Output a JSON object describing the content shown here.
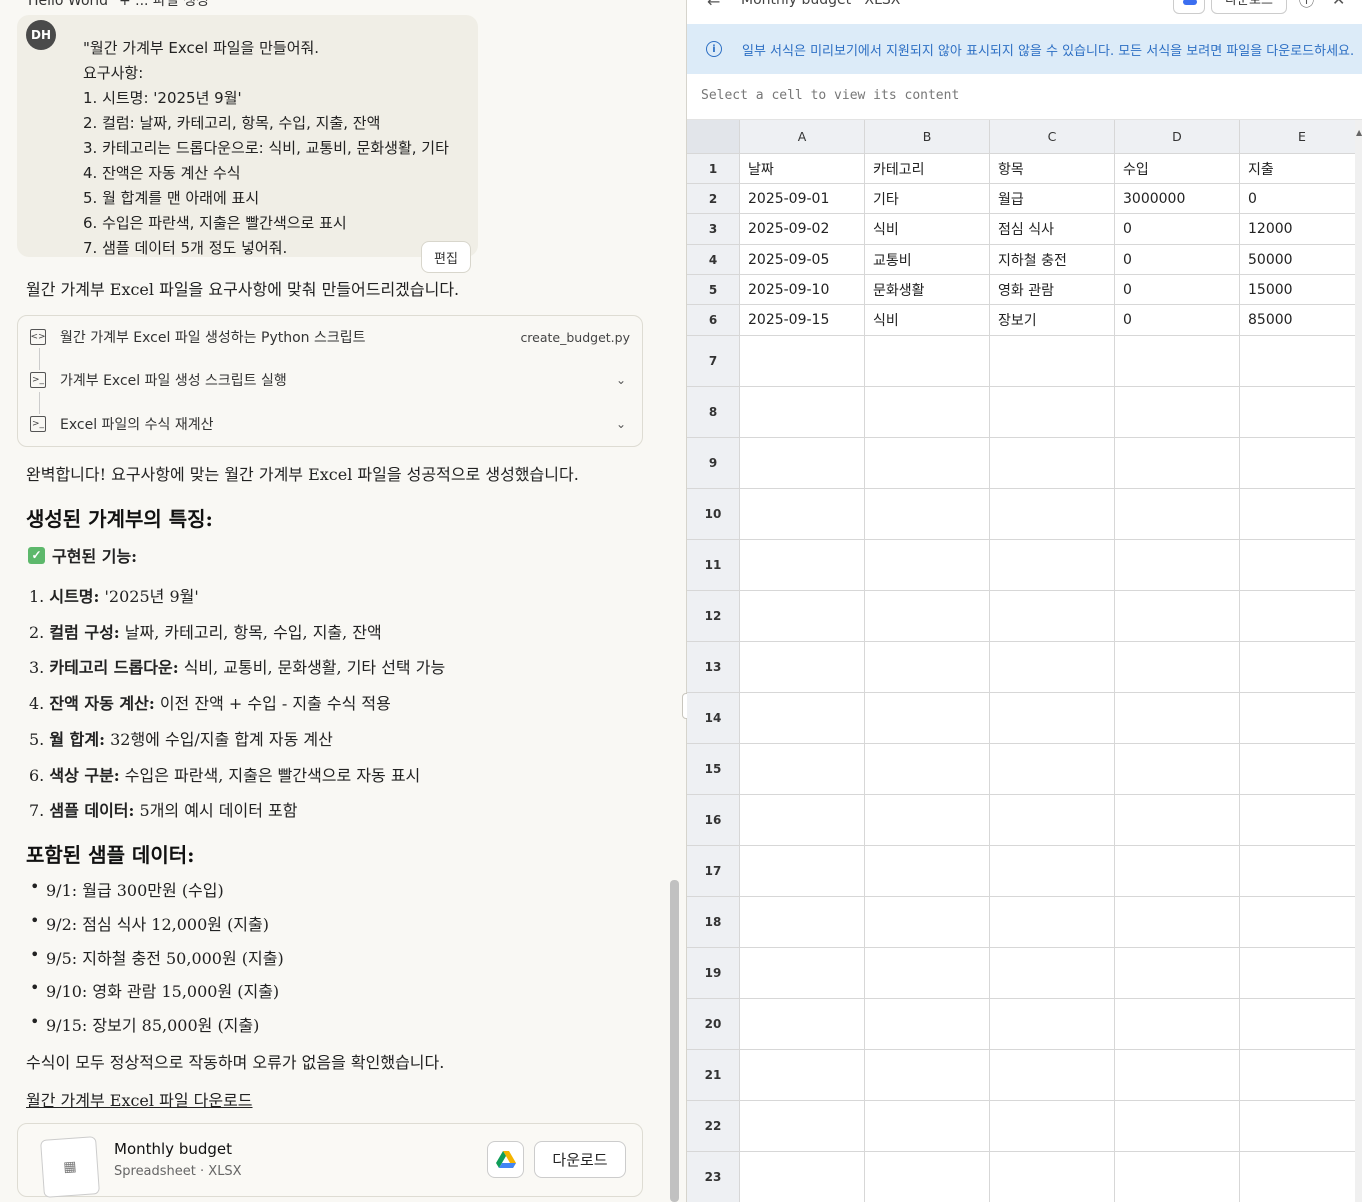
{
  "chat": {
    "top_cut_text": "Hello World\" + ... 파일 생성",
    "user": {
      "avatar": "DH",
      "lines": [
        "\"월간 가계부 Excel 파일을 만들어줘.",
        "요구사항:",
        "1. 시트명: '2025년 9월'",
        "2. 컬럼: 날짜, 카테고리, 항목, 수입, 지출, 잔액",
        "3. 카테고리는 드롭다운으로: 식비, 교통비, 문화생활, 기타",
        "4. 잔액은 자동 계산 수식",
        "5. 월 합계를 맨 아래에 표시",
        "6. 수입은 파란색, 지출은 빨간색으로 표시",
        "7. 샘플 데이터 5개 정도 넣어줘."
      ],
      "edit_label": "편집"
    },
    "intro": "월간 가계부 Excel 파일을 요구사항에 맞춰 만들어드리겠습니다.",
    "steps": [
      {
        "label": "월간 가계부 Excel 파일 생성하는 Python 스크립트",
        "file": "create_budget.py",
        "icon": "file-code-icon"
      },
      {
        "label": "가계부 Excel 파일 생성 스크립트 실행",
        "icon": "terminal-icon"
      },
      {
        "label": "Excel 파일의 수식 재계산",
        "icon": "terminal-icon"
      }
    ],
    "done": "완벽합니다! 요구사항에 맞는 월간 가계부 Excel 파일을 성공적으로 생성했습니다.",
    "features_heading": "생성된 가계부의 특징:",
    "implemented_label": "구현된 기능:",
    "features": [
      {
        "num": "1.",
        "key": "시트명:",
        "val": " '2025년 9월'"
      },
      {
        "num": "2.",
        "key": "컬럼 구성:",
        "val": " 날짜, 카테고리, 항목, 수입, 지출, 잔액"
      },
      {
        "num": "3.",
        "key": "카테고리 드롭다운:",
        "val": " 식비, 교통비, 문화생활, 기타 선택 가능"
      },
      {
        "num": "4.",
        "key": "잔액 자동 계산:",
        "val": " 이전 잔액 + 수입 - 지출 수식 적용"
      },
      {
        "num": "5.",
        "key": "월 합계:",
        "val": " 32행에 수입/지출 합계 자동 계산"
      },
      {
        "num": "6.",
        "key": "색상 구분:",
        "val": " 수입은 파란색, 지출은 빨간색으로 자동 표시"
      },
      {
        "num": "7.",
        "key": "샘플 데이터:",
        "val": " 5개의 예시 데이터 포함"
      }
    ],
    "sample_heading": "포함된 샘플 데이터:",
    "samples": [
      "9/1: 월급 300만원 (수입)",
      "9/2: 점심 식사 12,000원 (지출)",
      "9/5: 지하철 충전 50,000원 (지출)",
      "9/10: 영화 관람 15,000원 (지출)",
      "9/15: 장보기 85,000원 (지출)"
    ],
    "confirm": "수식이 모두 정상적으로 작동하며 오류가 없음을 확인했습니다.",
    "download_link": "월간 가계부 Excel 파일 다운로드",
    "file": {
      "name": "Monthly budget",
      "type": "Spreadsheet · XLSX",
      "download_label": "다운로드"
    }
  },
  "viewer": {
    "title": "Monthly budget · XLSX",
    "top_button": "다운로드",
    "banner": "일부 서식은 미리보기에서 지원되지 않아 표시되지 않을 수 있습니다. 모든 서식을 보려면 파일을 다운로드하세요.",
    "formula_placeholder": "Select a cell to view its content",
    "columns": [
      "A",
      "B",
      "C",
      "D",
      "E"
    ],
    "rows": [
      [
        "날짜",
        "카테고리",
        "항목",
        "수입",
        "지출"
      ],
      [
        "2025-09-01",
        "기타",
        "월급",
        "3000000",
        "0"
      ],
      [
        "2025-09-02",
        "식비",
        "점심 식사",
        "0",
        "12000"
      ],
      [
        "2025-09-05",
        "교통비",
        "지하철 충전",
        "0",
        "50000"
      ],
      [
        "2025-09-10",
        "문화생활",
        "영화 관람",
        "0",
        "15000"
      ],
      [
        "2025-09-15",
        "식비",
        "장보기",
        "0",
        "85000"
      ]
    ],
    "row_numbers": [
      "1",
      "2",
      "3",
      "4",
      "5",
      "6",
      "7",
      "8",
      "9",
      "10",
      "11",
      "12",
      "13",
      "14",
      "15",
      "16",
      "17",
      "18",
      "19",
      "20",
      "21",
      "22",
      "23"
    ]
  }
}
